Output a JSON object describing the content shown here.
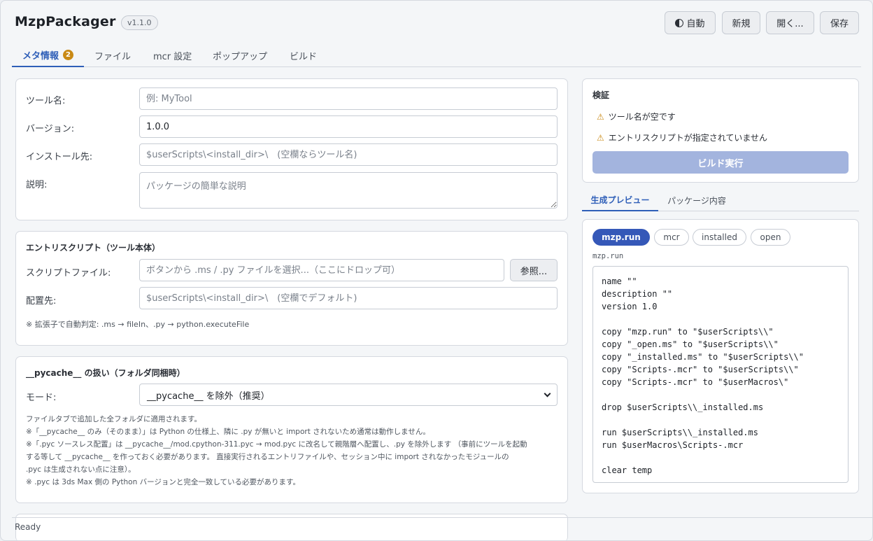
{
  "app": {
    "title": "MzpPackager",
    "version": "v1.1.0",
    "buttons": {
      "theme": "自動",
      "new": "新規",
      "open": "開く...",
      "save": "保存"
    }
  },
  "tabs": [
    {
      "label": "メタ情報",
      "badge": "2"
    },
    {
      "label": "ファイル"
    },
    {
      "label": "mcr 設定"
    },
    {
      "label": "ポップアップ"
    },
    {
      "label": "ビルド"
    }
  ],
  "meta": {
    "tool_name_label": "ツール名:",
    "tool_name_placeholder": "例: MyTool",
    "version_label": "バージョン:",
    "version_value": "1.0.0",
    "install_label": "インストール先:",
    "install_placeholder": "$userScripts\\<install_dir>\\　(空欄ならツール名)",
    "desc_label": "説明:",
    "desc_placeholder": "パッケージの簡単な説明"
  },
  "entry": {
    "title": "エントリスクリプト（ツール本体）",
    "file_label": "スクリプトファイル:",
    "file_placeholder": "ボタンから .ms / .py ファイルを選択...（ここにドロップ可）",
    "browse": "参照...",
    "dest_label": "配置先:",
    "dest_placeholder": "$userScripts\\<install_dir>\\　(空欄でデフォルト)",
    "hint": "※ 拡張子で自動判定: .ms → fileIn、.py → python.executeFile"
  },
  "pycache": {
    "title": "__pycache__ の扱い（フォルダ同梱時）",
    "mode_label": "モード:",
    "mode_value": "__pycache__ を除外（推奨）",
    "notes": [
      "ファイルタブで追加した全フォルダに適用されます。",
      "※「__pycache__ のみ（そのまま）」は Python の仕様上、隣に .py が無いと import されないため通常は動作しません。",
      "※「.pyc ソースレス配置」は __pycache__/mod.cpython-311.pyc → mod.pyc に改名して親階層へ配置し、.py を除外します （事前にツールを起動",
      "する等して __pycache__ を作っておく必要があります。 直接実行されるエントリファイルや、セッション中に import されなかったモジュールの",
      ".pyc は生成されない点に注意）。",
      "※ .pyc は 3ds Max 側の Python バージョンと完全一致している必要があります。"
    ]
  },
  "validation": {
    "title": "検証",
    "warnings": [
      "ツール名が空です",
      "エントリスクリプトが指定されていません"
    ],
    "build_button": "ビルド実行"
  },
  "preview": {
    "tabs": [
      "生成プレビュー",
      "パッケージ内容"
    ],
    "files": [
      "mzp.run",
      "mcr",
      "installed",
      "open"
    ],
    "current_file": "mzp.run",
    "code": [
      "name \"\"",
      "description \"\"",
      "version 1.0",
      "",
      "copy \"mzp.run\" to \"$userScripts\\\\\"",
      "copy \"_open.ms\" to \"$userScripts\\\\\"",
      "copy \"_installed.ms\" to \"$userScripts\\\\\"",
      "copy \"Scripts-.mcr\" to \"$userScripts\\\\\"",
      "copy \"Scripts-.mcr\" to \"$userMacros\\\"",
      "",
      "drop $userScripts\\\\_installed.ms",
      "",
      "run $userScripts\\\\_installed.ms",
      "run $userMacros\\Scripts-.mcr",
      "",
      "clear temp"
    ]
  },
  "status": "Ready"
}
